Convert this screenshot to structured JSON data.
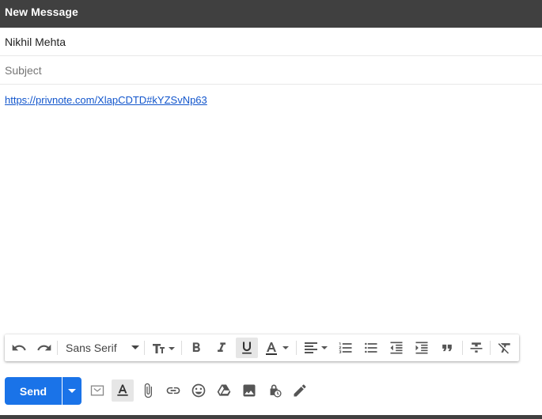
{
  "window": {
    "title": "New Message"
  },
  "recipients": {
    "value": "Nikhil Mehta"
  },
  "subject": {
    "placeholder": "Subject"
  },
  "body": {
    "link_text": "https://privnote.com/XlapCDTD#kYZSvNp63"
  },
  "toolbar": {
    "font_name": "Sans Serif",
    "buttons": [
      "undo",
      "redo",
      "font-size",
      "bold",
      "italic",
      "underline",
      "text-color",
      "align",
      "numbered-list",
      "bulleted-list",
      "indent-less",
      "indent-more",
      "quote",
      "strikethrough",
      "remove-formatting"
    ],
    "active": [
      "underline"
    ]
  },
  "bottom_bar": {
    "send_label": "Send",
    "icons": [
      "confidential-mode",
      "formatting-options",
      "attach-files",
      "insert-link",
      "insert-emoji",
      "google-drive",
      "insert-photo",
      "confidential-lock-clock",
      "signature"
    ],
    "active": [
      "formatting-options"
    ]
  },
  "colors": {
    "header": "#404040",
    "send": "#1a73e8",
    "link": "#1155cc"
  }
}
